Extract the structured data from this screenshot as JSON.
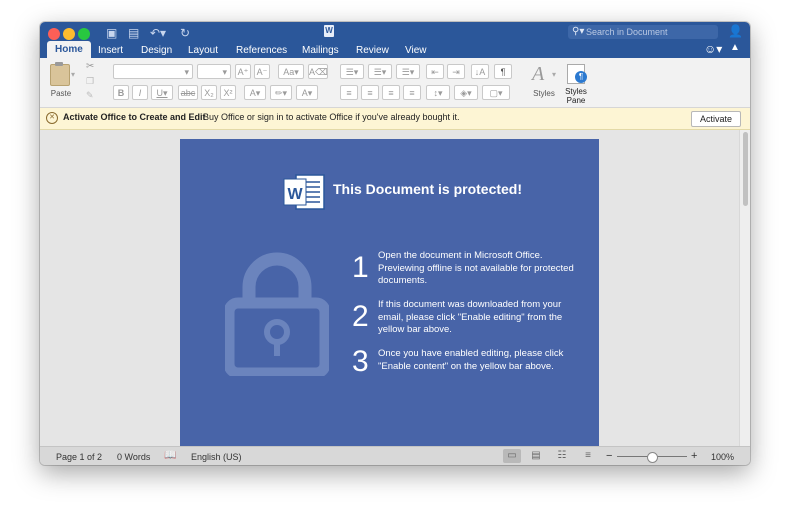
{
  "tabs": [
    "Home",
    "Insert",
    "Design",
    "Layout",
    "References",
    "Mailings",
    "Review",
    "View"
  ],
  "search": {
    "placeholder": "Search in Document"
  },
  "ribbon": {
    "paste_label": "Paste",
    "styles_label": "Styles",
    "styles_pane_label_1": "Styles",
    "styles_pane_label_2": "Pane"
  },
  "notice": {
    "title": "Activate Office to Create and Edit",
    "message": "Buy Office or sign in to activate Office if you've already bought it.",
    "button": "Activate"
  },
  "document": {
    "title": "This Document is protected!",
    "steps": [
      {
        "num": "1",
        "text": "Open the document in Microsoft Office. Previewing offline is not available for protected documents."
      },
      {
        "num": "2",
        "text": "If this document was downloaded from your email, please click \"Enable editing\" from the yellow bar above."
      },
      {
        "num": "3",
        "text": "Once you have enabled editing, please click \"Enable content\" on the yellow bar above."
      }
    ]
  },
  "status": {
    "page": "Page 1 of 2",
    "words": "0 Words",
    "language": "English (US)",
    "zoom": "100%"
  },
  "colors": {
    "title_bar": "#2b579a",
    "document_panel": "#4864a8",
    "notice_bar": "#fdf5d4"
  }
}
